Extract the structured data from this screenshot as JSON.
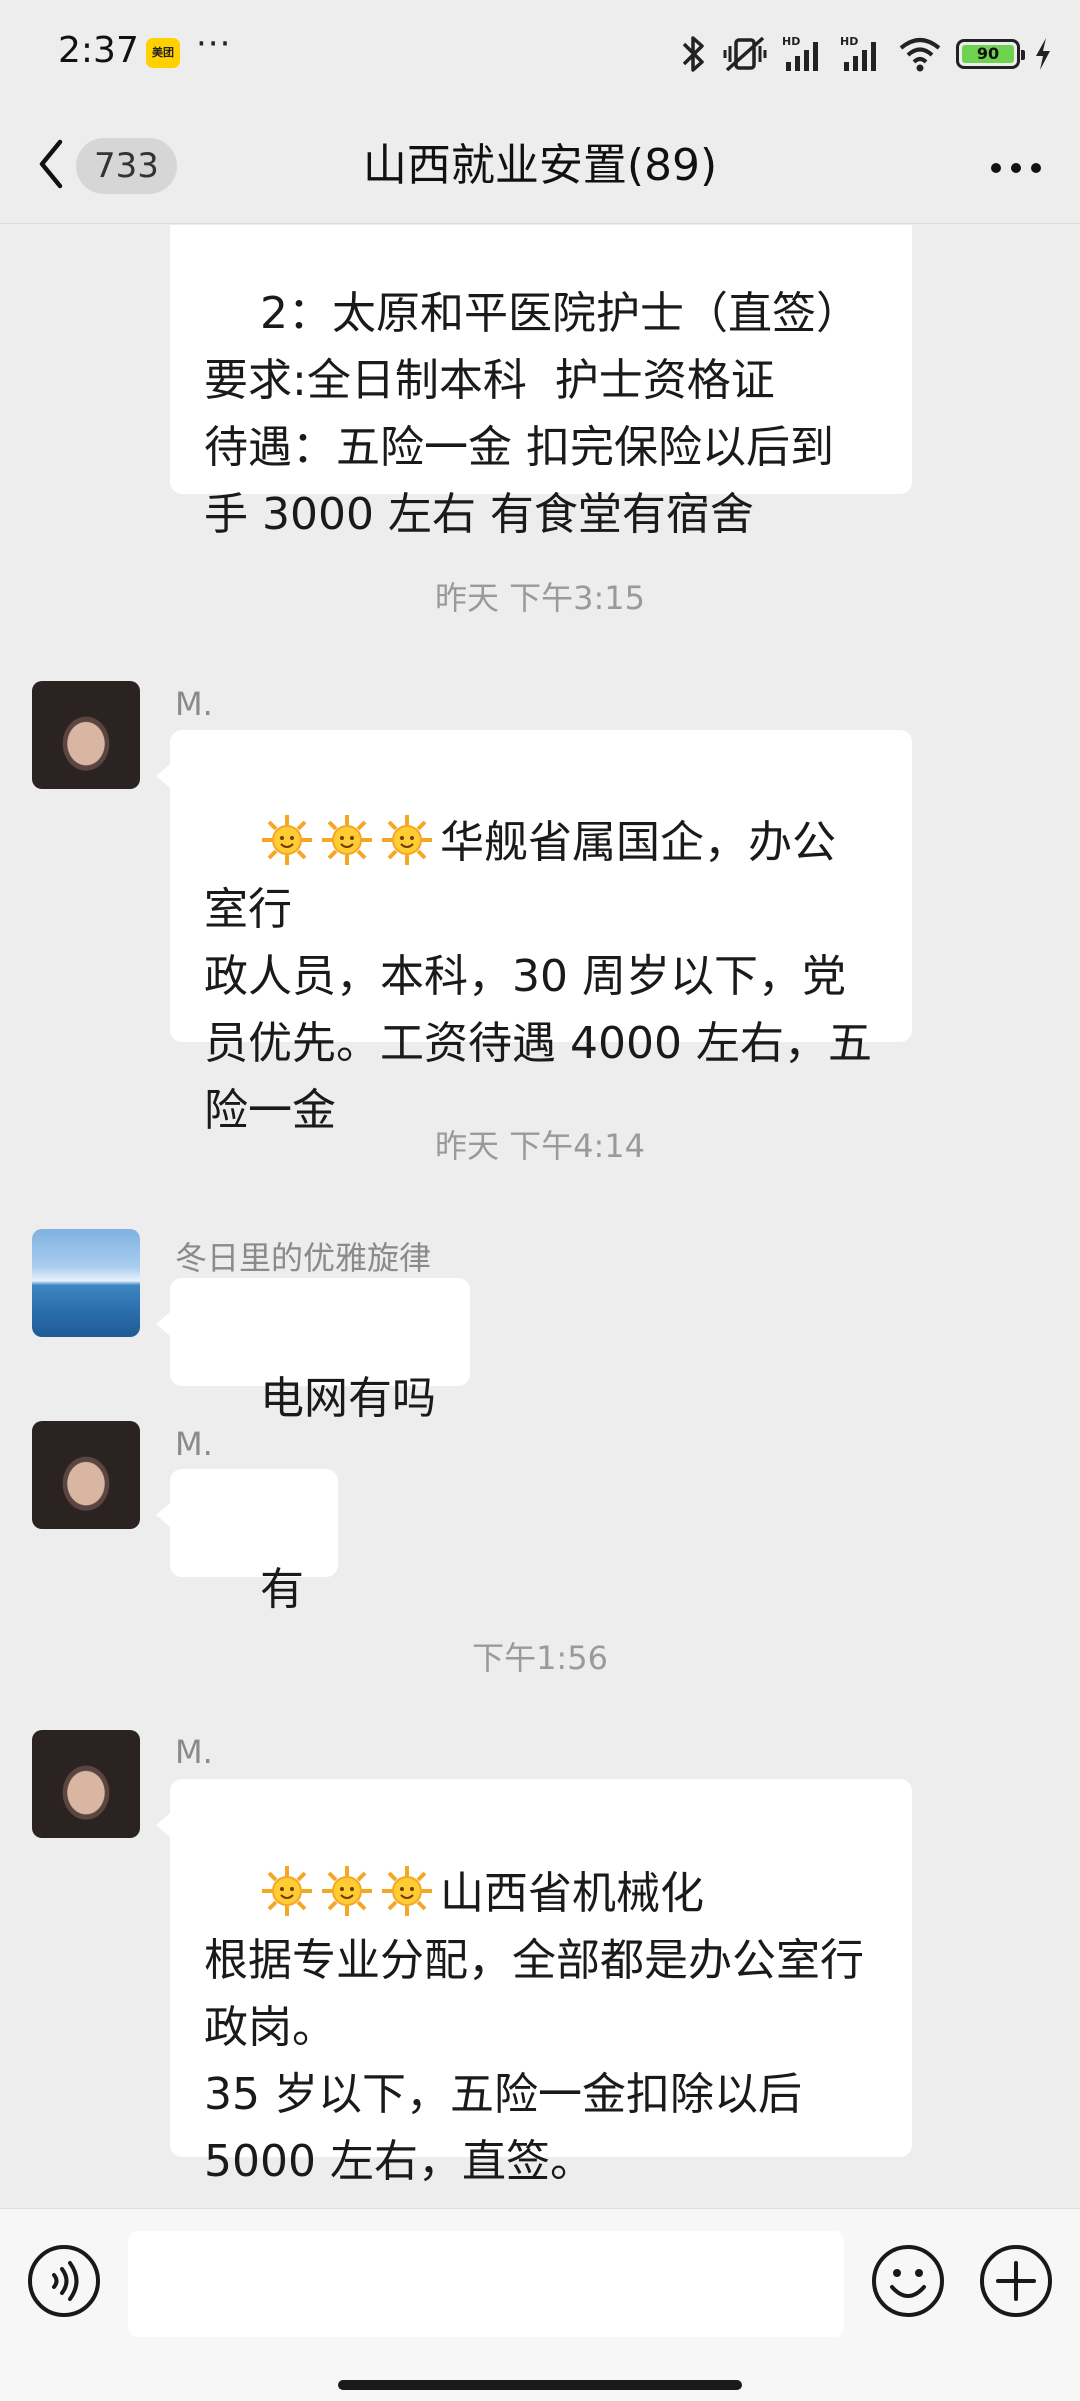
{
  "status_bar": {
    "time": "2:37",
    "app_badge": "美团",
    "more": "···",
    "battery": "90"
  },
  "header": {
    "back_count": "733",
    "title": "山西就业安置(89)"
  },
  "messages": [
    {
      "type": "partial_text",
      "text": "2：太原和平医院护士（直签）\n要求:全日制本科  护士资格证\n待遇：五险一金 扣完保险以后到\n手 3000 左右 有食堂有宿舍"
    },
    {
      "type": "time",
      "text": "昨天 下午3:15"
    },
    {
      "type": "text",
      "sender": "M.",
      "avatar": "woman-avatar",
      "text": "华舰省属国企，办公室行\n政人员，本科，30 周岁以下，党\n员优先。工资待遇 4000 左右，五\n险一金"
    },
    {
      "type": "time",
      "text": "昨天 下午4:14"
    },
    {
      "type": "text",
      "sender": "冬日里的优雅旋律",
      "avatar": "sea-avatar",
      "text": "电网有吗"
    },
    {
      "type": "text",
      "sender": "M.",
      "avatar": "woman-avatar",
      "text": "有"
    },
    {
      "type": "time",
      "text": "下午1:56"
    },
    {
      "type": "text",
      "sender": "M.",
      "avatar": "woman-avatar",
      "text": "山西省机械化\n根据专业分配，全部都是办公室行\n政岗。\n35 岁以下，五险一金扣除以后\n5000 左右，直签。"
    }
  ],
  "input_bar": {
    "placeholder": "",
    "value": ""
  },
  "colors": {
    "background": "#ededed",
    "bubble": "#ffffff",
    "battery_fill": "#6dd34f"
  }
}
